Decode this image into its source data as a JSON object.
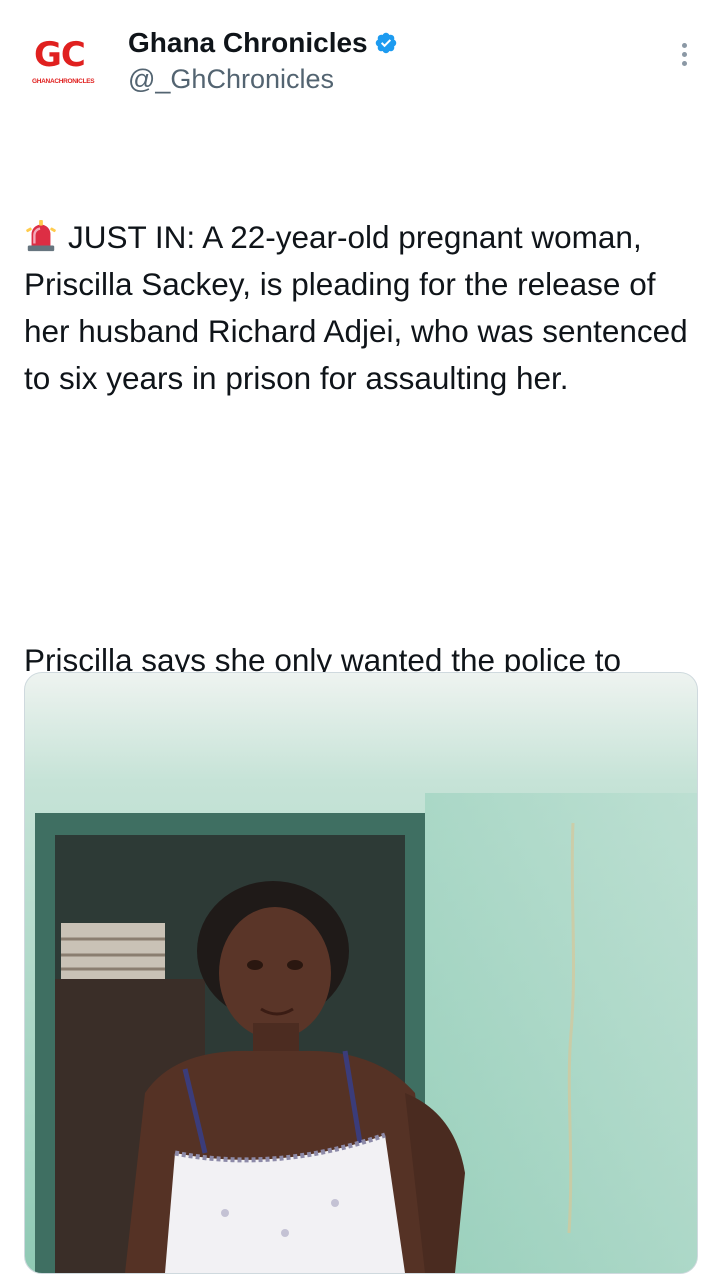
{
  "account": {
    "display_name": "Ghana Chronicles",
    "handle": "@_GhChronicles",
    "avatar_text": "GC",
    "avatar_subtext": "GHANACHRONICLES",
    "verified_icon": "verified-badge-icon",
    "brand_color": "#e0201f",
    "verified_color": "#1d9bf0"
  },
  "tweet": {
    "paragraph_1_icon": "police-siren-emoji",
    "paragraph_1": "JUST IN: A 22-year-old pregnant woman, Priscilla Sackey, is pleading for the release of her husband Richard Adjei, who was sentenced to six years in prison for assaulting her.",
    "paragraph_2": "Priscilla says she only wanted the police to caution him after he assaulted her twice, but the case resulted in a jail term. Despite the abuse, she says she still needs his support to care for their child."
  },
  "media": {
    "type": "photo",
    "icon": "photo-woman-doorway"
  }
}
